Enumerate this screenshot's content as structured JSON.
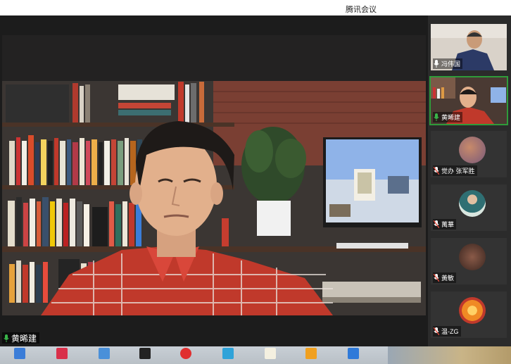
{
  "app": {
    "title": "腾讯会议"
  },
  "main_video": {
    "speaker_name": "黄晞建",
    "mic": "mic-on-green-icon"
  },
  "participants": [
    {
      "name": "冯伟国",
      "mic": "mic-on-icon",
      "type": "video"
    },
    {
      "name": "黄晞建",
      "mic": "mic-on-green-icon",
      "type": "video",
      "active": true
    },
    {
      "name": "觉办 张军胜",
      "mic": "mic-muted-icon",
      "type": "avatar"
    },
    {
      "name": "萬華",
      "mic": "mic-muted-icon",
      "type": "avatar"
    },
    {
      "name": "黃敏",
      "mic": "mic-muted-icon",
      "type": "avatar"
    },
    {
      "name": "温-ZG",
      "mic": "mic-muted-icon",
      "type": "avatar"
    }
  ],
  "colors": {
    "active_border": "#2f9b3a",
    "stage_bg": "#1c1c1c",
    "sidebar_bg": "#2b2b2b"
  }
}
